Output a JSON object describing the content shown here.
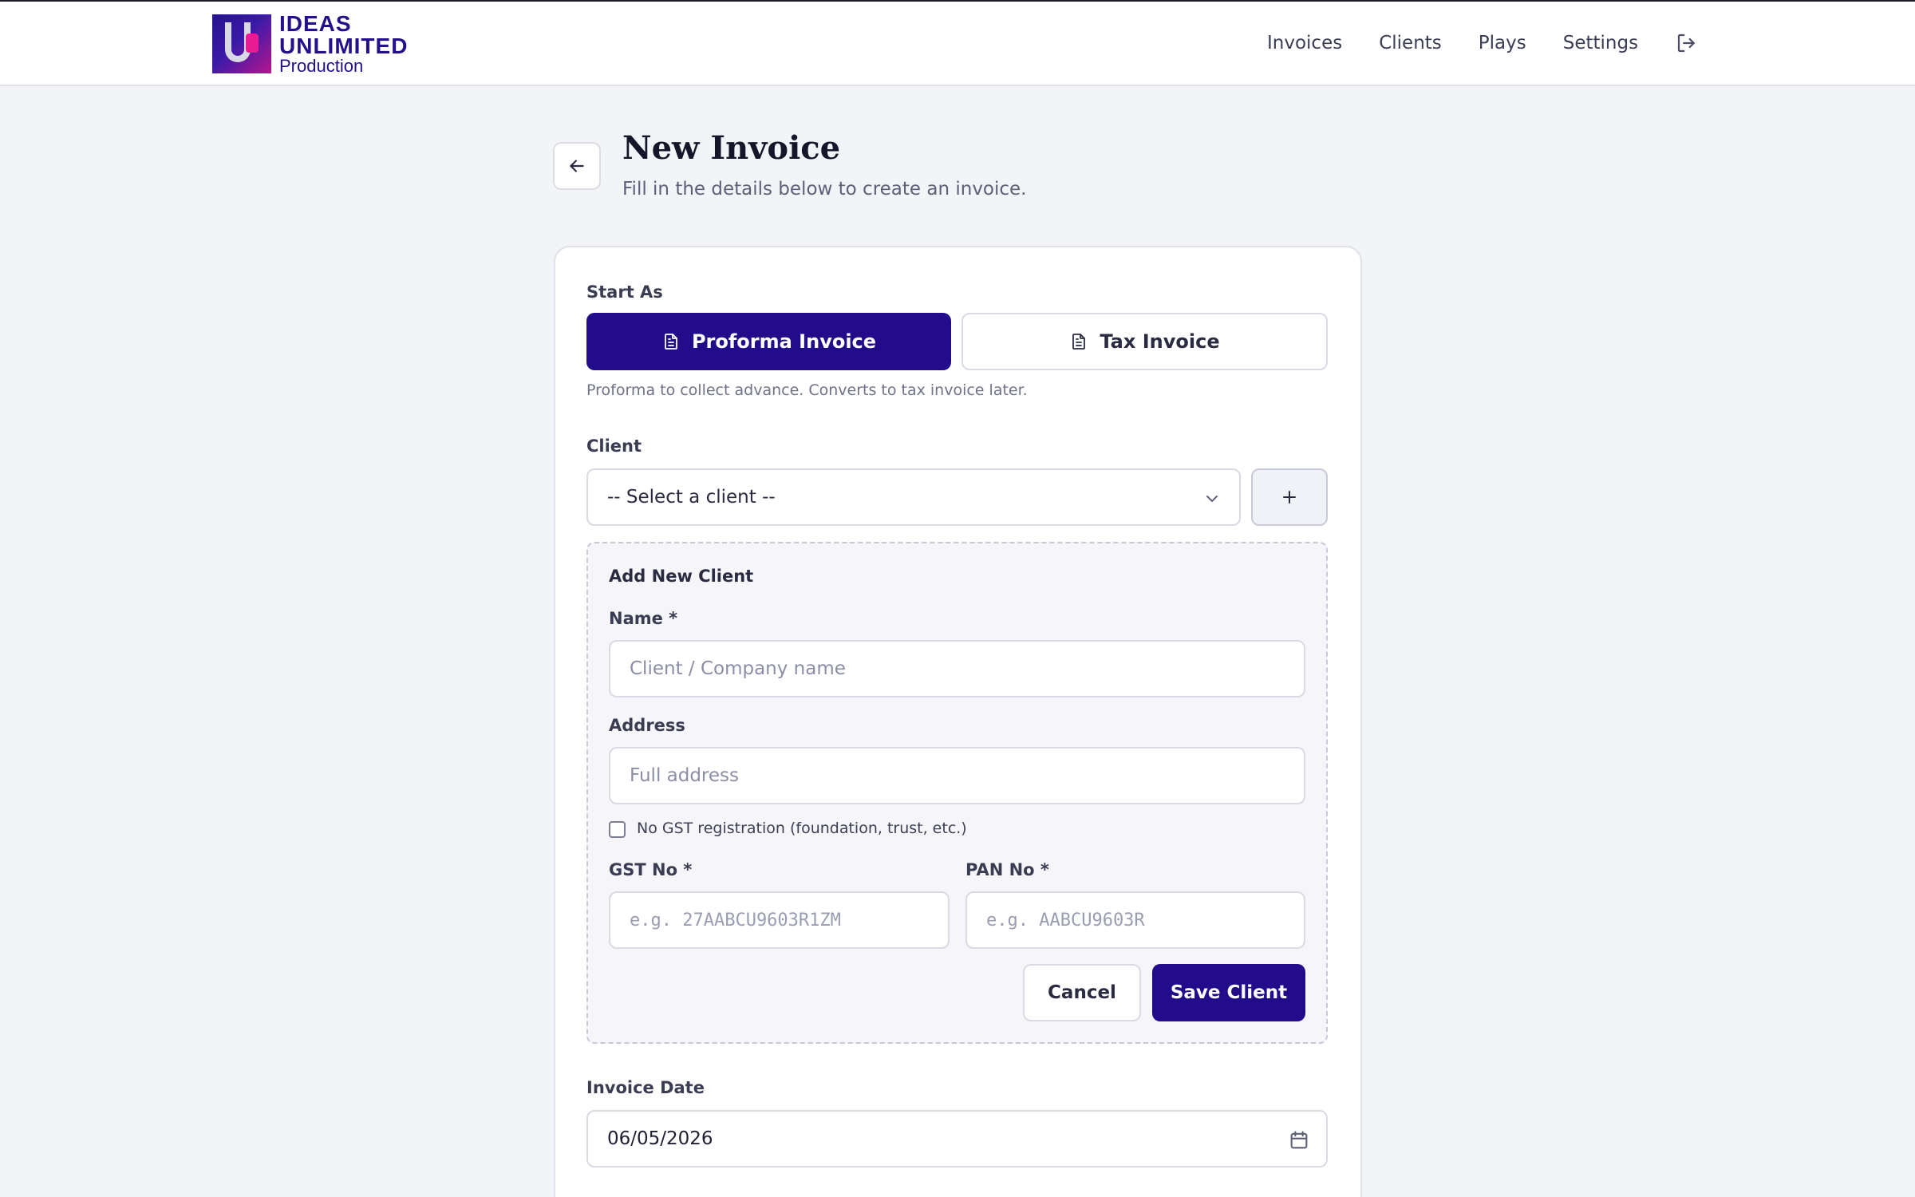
{
  "brand": {
    "line1": "IDEAS",
    "line2": "UNLIMITED",
    "line3": "Production"
  },
  "nav": {
    "items": [
      "Invoices",
      "Clients",
      "Plays",
      "Settings"
    ],
    "logout_icon": "logout-icon"
  },
  "header": {
    "title": "New Invoice",
    "subtitle": "Fill in the details below to create an invoice."
  },
  "form": {
    "start_as_label": "Start As",
    "proforma_label": "Proforma Invoice",
    "tax_label": "Tax Invoice",
    "start_as_hint": "Proforma to collect advance. Converts to tax invoice later.",
    "client_label": "Client",
    "client_select_value": "-- Select a client --",
    "new_client": {
      "heading": "Add New Client",
      "name_label": "Name *",
      "name_placeholder": "Client / Company name",
      "address_label": "Address",
      "address_placeholder": "Full address",
      "no_gst_label": "No GST registration (foundation, trust, etc.)",
      "gst_label": "GST No *",
      "gst_placeholder": "e.g. 27AABCU9603R1ZM",
      "pan_label": "PAN No *",
      "pan_placeholder": "e.g. AABCU9603R",
      "cancel_label": "Cancel",
      "save_label": "Save Client"
    },
    "invoice_date_label": "Invoice Date",
    "invoice_date_value": "06/05/2026"
  },
  "colors": {
    "primary": "#230c8a",
    "background": "#f3f4f8",
    "border": "#d9dae3"
  }
}
